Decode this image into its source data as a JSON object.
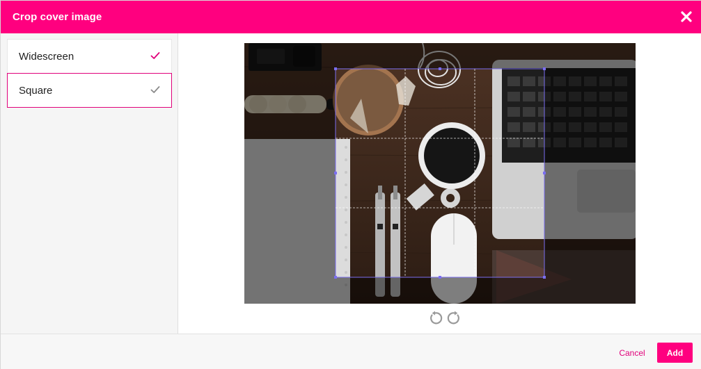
{
  "header": {
    "title": "Crop cover image"
  },
  "options": [
    {
      "label": "Widescreen",
      "selected": false
    },
    {
      "label": "Square",
      "selected": true
    }
  ],
  "icons": {
    "close": "close-icon",
    "check": "check-icon",
    "rotate_left": "rotate-left-icon",
    "rotate_right": "rotate-right-icon"
  },
  "colors": {
    "brand": "#ff007f",
    "crop_handle": "#7b6ef0",
    "check_active": "#e0007a",
    "check_inactive": "#8a8a8a"
  },
  "footer": {
    "cancel_label": "Cancel",
    "add_label": "Add"
  }
}
